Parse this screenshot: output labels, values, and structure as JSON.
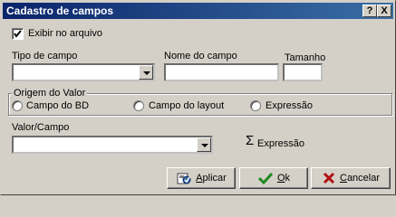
{
  "window": {
    "title": "Cadastro de campos",
    "help_glyph": "?",
    "close_glyph": "X"
  },
  "form": {
    "show_in_file_label": "Exibir no arquivo",
    "show_in_file_checked": true,
    "field_type_label": "Tipo de campo",
    "field_type_value": "",
    "field_name_label": "Nome do campo",
    "field_name_value": "",
    "size_label": "Tamanho",
    "size_value": "",
    "origin_group_label": "Origem do Valor",
    "origin_options": [
      "Campo do BD",
      "Campo do layout",
      "Expressão"
    ],
    "value_field_label": "Valor/Campo",
    "value_field_value": "",
    "sigma_glyph": "Σ",
    "expression_label": "Expressão"
  },
  "buttons": {
    "apply_accel": "A",
    "apply_rest": "plicar",
    "ok_accel": "O",
    "ok_rest": "k",
    "cancel_accel": "C",
    "cancel_rest": "ancelar"
  },
  "colors": {
    "titlebar_start": "#0a246a",
    "titlebar_end": "#3a6ea5",
    "face": "#d4d0c8",
    "check_green": "#1c8a1c",
    "cancel_red": "#b01010"
  }
}
